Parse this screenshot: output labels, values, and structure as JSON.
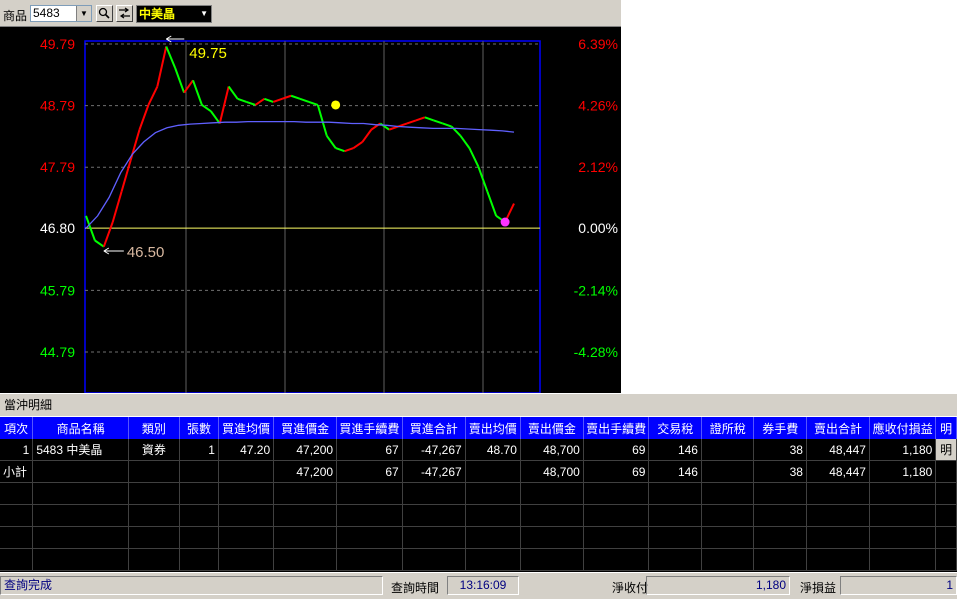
{
  "toolbar": {
    "product_label": "商品",
    "symbol_value": "5483",
    "stock_name": "中美晶"
  },
  "chart_data": {
    "type": "line",
    "reference_price": 46.8,
    "y_ticks_left": [
      "49.79",
      "48.79",
      "47.79",
      "46.80",
      "45.79",
      "44.79"
    ],
    "y_ticks_right": [
      "6.39%",
      "4.26%",
      "2.12%",
      "0.00%",
      "-2.14%",
      "-4.28%"
    ],
    "ylim": [
      44.3,
      50.15
    ],
    "high_label": "49.75",
    "low_label": "46.50",
    "high": 49.75,
    "low": 46.5,
    "price_series": [
      47.0,
      46.6,
      46.5,
      46.9,
      47.4,
      47.9,
      48.4,
      48.8,
      49.1,
      49.75,
      49.4,
      49.0,
      49.2,
      48.8,
      48.7,
      48.5,
      49.1,
      48.9,
      48.85,
      48.8,
      48.9,
      48.85,
      48.9,
      48.95,
      48.9,
      48.85,
      48.8,
      48.3,
      48.1,
      48.05,
      48.1,
      48.2,
      48.4,
      48.5,
      48.4,
      48.45,
      48.5,
      48.55,
      48.6,
      48.55,
      48.5,
      48.45,
      48.3,
      48.1,
      47.8,
      47.4,
      47.0,
      46.9,
      47.2
    ],
    "avg_series": [
      46.8,
      47.0,
      47.3,
      47.7,
      48.0,
      48.2,
      48.35,
      48.43,
      48.47,
      48.49,
      48.5,
      48.51,
      48.52,
      48.52,
      48.53,
      48.53,
      48.53,
      48.53,
      48.53,
      48.52,
      48.52,
      48.52,
      48.51,
      48.5,
      48.5,
      48.48,
      48.47,
      48.45,
      48.44,
      48.43,
      48.42,
      48.42,
      48.42,
      48.41,
      48.4,
      48.39,
      48.38,
      48.36
    ],
    "markers": [
      {
        "name": "yellow-marker",
        "index": 28,
        "value": 48.8,
        "color": "#ffff00"
      },
      {
        "name": "magenta-marker",
        "index": 47,
        "value": 46.9,
        "color": "#ff33ff"
      }
    ],
    "colors": {
      "up": "#ff0000",
      "down": "#00ff00",
      "avg": "#6060ff",
      "ref": "#ffff66",
      "frame": "#0000ff",
      "high": "#ffff00",
      "low": "#d8b8a0"
    }
  },
  "detail_panel": {
    "title": "當沖明細",
    "columns": [
      "項次",
      "商品名稱",
      "類別",
      "張數",
      "買進均價",
      "買進價金",
      "買進手續費",
      "買進合計",
      "賣出均價",
      "賣出價金",
      "賣出手續費",
      "交易稅",
      "證所稅",
      "券手費",
      "賣出合計",
      "應收付損益",
      "明"
    ],
    "rows": [
      [
        "1",
        "5483 中美晶",
        "資券",
        "1",
        "47.20",
        "47,200",
        "67",
        "-47,267",
        "48.70",
        "48,700",
        "69",
        "146",
        "",
        "38",
        "48,447",
        "1,180",
        "明"
      ],
      [
        "小計",
        "",
        "",
        "",
        "",
        "47,200",
        "67",
        "-47,267",
        "",
        "48,700",
        "69",
        "146",
        "",
        "38",
        "48,447",
        "1,180",
        ""
      ]
    ]
  },
  "status": {
    "message": "查詢完成",
    "query_time_label": "查詢時間",
    "query_time": "13:16:09",
    "net_receive_label": "淨收付",
    "net_receive": "1,180",
    "net_pl_label": "淨損益",
    "net_pl": "1"
  }
}
